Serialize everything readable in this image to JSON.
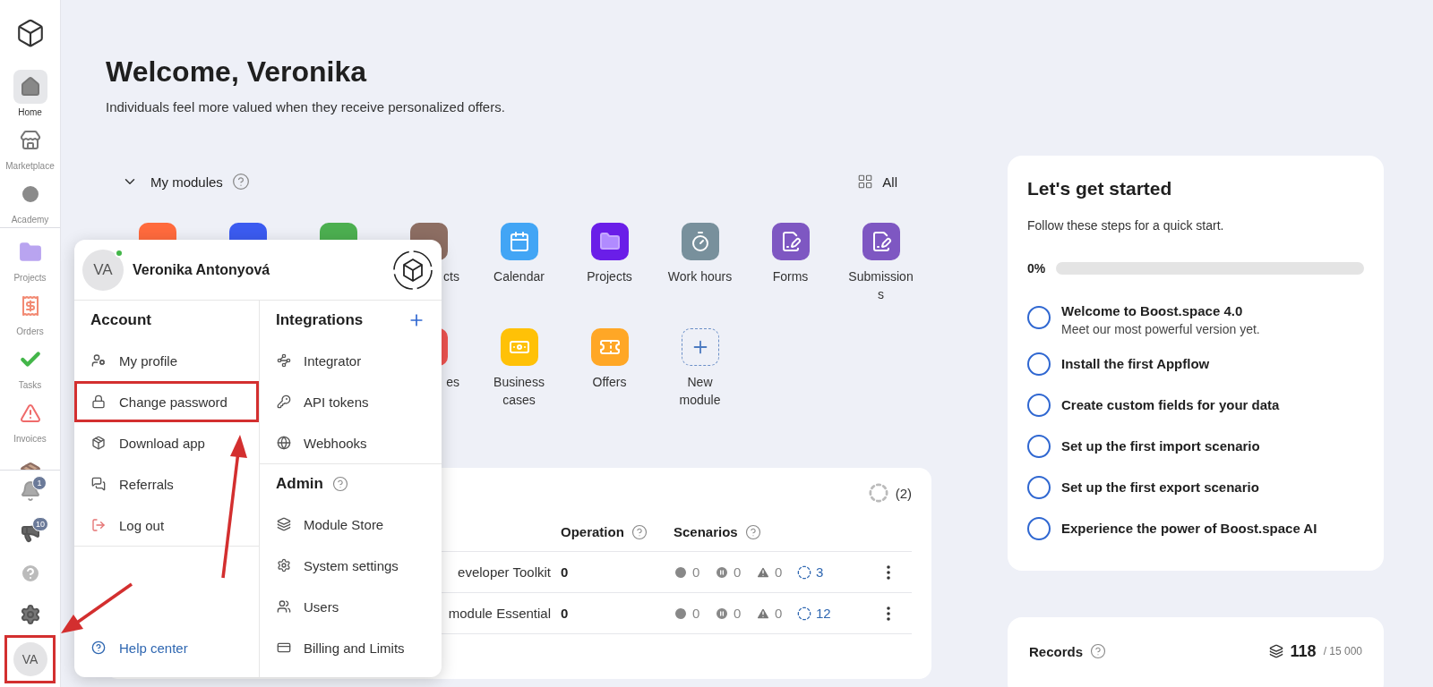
{
  "sidebar": {
    "nav": [
      {
        "label": "Home",
        "selected": true
      },
      {
        "label": "Marketplace",
        "selected": false
      },
      {
        "label": "Academy",
        "selected": false
      }
    ],
    "modules": [
      {
        "label": "Projects",
        "selected": false
      },
      {
        "label": "Orders",
        "selected": false
      },
      {
        "label": "Tasks",
        "selected": false
      },
      {
        "label": "Invoices",
        "selected": false
      },
      {
        "selected": false
      }
    ],
    "notifications": "1",
    "announcements": "10",
    "avatar": {
      "initials": "VA",
      "highlighted": true
    }
  },
  "header": {
    "title": "Welcome, Veronika",
    "subtitle": "Individuals feel more valued when they receive personalized offers."
  },
  "my_modules": {
    "expanded": true,
    "title": "My modules",
    "all_label": "All",
    "rows": [
      {
        "items": [
          {
            "kind": "app",
            "color": "#ff6a3d"
          },
          {
            "kind": "app",
            "color": "#3b5bf0"
          },
          {
            "kind": "app",
            "color": "#4caf50"
          },
          {
            "kind": "cut",
            "label": "cts",
            "color": "#8d6e63"
          },
          {
            "kind": "app",
            "label": "Calendar",
            "color": "#42a5f5"
          },
          {
            "kind": "app",
            "label": "Projects",
            "color": "#6a1ee8"
          },
          {
            "kind": "app",
            "label": "Work hours",
            "color": "#78909c"
          },
          {
            "kind": "app",
            "label": "Forms",
            "color": "#7e57c2"
          },
          {
            "kind": "app",
            "label": "Submissions",
            "color": "#7e57c2"
          }
        ]
      },
      {
        "items": [
          {
            "kind": "cut",
            "label": "es",
            "color": "#ef5350"
          },
          {
            "kind": "app",
            "label": "Business cases",
            "color": "#ffc107"
          },
          {
            "kind": "app",
            "label": "Offers",
            "color": "#ffa726"
          },
          {
            "kind": "new",
            "label": "New module"
          }
        ]
      }
    ]
  },
  "scenarios_table": {
    "count": "(2)",
    "columns": [
      {
        "label": "Operation"
      },
      {
        "label": "Scenarios"
      }
    ],
    "rows": [
      {
        "name": "eveloper Toolkit",
        "operations": "0",
        "running": "0",
        "paused": "0",
        "errors": "0",
        "total": "3"
      },
      {
        "name": "module Essential",
        "operations": "0",
        "running": "0",
        "paused": "0",
        "errors": "0",
        "total": "12"
      }
    ]
  },
  "getting_started": {
    "title": "Let's get started",
    "subtitle": "Follow these steps for a quick start.",
    "progress_label": "0%",
    "level": 0,
    "steps": [
      {
        "title": "Welcome to Boost.space 4.0",
        "description": "Meet our most powerful version yet.",
        "checked": false
      },
      {
        "title": "Install the first Appflow",
        "checked": false
      },
      {
        "title": "Create custom fields for your data",
        "checked": false
      },
      {
        "title": "Set up the first import scenario",
        "checked": false
      },
      {
        "title": "Set up the first export scenario",
        "checked": false
      },
      {
        "title": "Experience the power of Boost.space AI",
        "checked": false
      }
    ]
  },
  "records": {
    "label": "Records",
    "value": "118",
    "limit": "/ 15 000"
  },
  "user_menu": {
    "user": {
      "initials": "VA",
      "name": "Veronika Antonyová",
      "online": true
    },
    "account": {
      "title": "Account",
      "items": [
        {
          "label": "My profile",
          "highlighted": false
        },
        {
          "label": "Change password",
          "highlighted": true
        },
        {
          "label": "Download app",
          "highlighted": false
        },
        {
          "label": "Referrals",
          "highlighted": false
        },
        {
          "label": "Log out",
          "highlighted": false
        }
      ]
    },
    "help_center": "Help center",
    "integrations": {
      "title": "Integrations",
      "items": [
        {
          "label": "Integrator",
          "highlighted": false
        },
        {
          "label": "API tokens",
          "highlighted": false
        },
        {
          "label": "Webhooks",
          "highlighted": false
        }
      ]
    },
    "admin": {
      "title": "Admin",
      "items": [
        {
          "label": "Module Store",
          "highlighted": false
        },
        {
          "label": "System settings",
          "highlighted": false
        },
        {
          "label": "Users",
          "highlighted": false
        },
        {
          "label": "Billing and Limits",
          "highlighted": false
        }
      ]
    }
  }
}
